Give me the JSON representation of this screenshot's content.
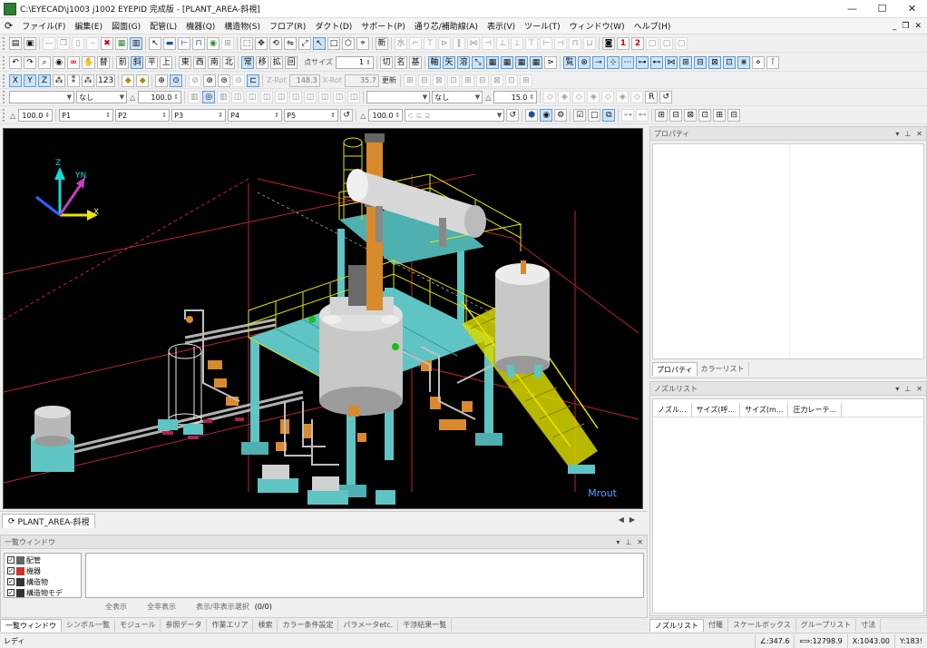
{
  "window": {
    "title": "C:\\EYECAD\\j1003 j1002 EYEPID 完成版 - [PLANT_AREA-斜視]",
    "minimize": "—",
    "maximize": "☐",
    "close": "✕"
  },
  "menu": [
    "ファイル(F)",
    "編集(E)",
    "図面(G)",
    "配管(L)",
    "機器(Q)",
    "構造物(S)",
    "フロア(R)",
    "ダクト(D)",
    "サポート(P)",
    "通り芯/補助線(A)",
    "表示(V)",
    "ツール(T)",
    "ウィンドウ(W)",
    "ヘルプ(H)"
  ],
  "mdi_controls": {
    "minimize": "_",
    "restore": "❐",
    "close": "✕"
  },
  "toolbar2": {
    "text_buttons": [
      "替",
      "前",
      "斜",
      "平",
      "上",
      "東",
      "西",
      "南",
      "北",
      "常",
      "移",
      "拡",
      "回"
    ],
    "point_size_label": "点サイズ",
    "point_size_value": "1",
    "text_buttons_b": [
      "切",
      "名",
      "基",
      "軸",
      "矢",
      "溶"
    ]
  },
  "toolbar3": {
    "zrot_label": "Z-Rot",
    "zrot_value": "148.3",
    "xrot_label": "X-Rot",
    "xrot_value": "35.7",
    "update_label": "更新"
  },
  "toolbar4": {
    "combo1": "",
    "combo2": "なし",
    "size_value": "100.0",
    "combo3": "",
    "combo4": "なし",
    "angle_value": "15.0",
    "r_label": "R"
  },
  "toolbar5": {
    "scale_value": "100.0",
    "params": [
      "P1",
      "P2",
      "P3",
      "P4",
      "P5"
    ]
  },
  "viewport": {
    "axis_x": "X",
    "axis_y": "YN",
    "axis_z": "Z",
    "overlay_text": "Mrout"
  },
  "doc_tab": {
    "label": "PLANT_AREA-斜視",
    "nav_prev": "◀",
    "nav_next": "▶"
  },
  "list_window": {
    "title": "一覧ウィンドウ",
    "tree_items": [
      "配管",
      "機器",
      "構造物",
      "構造物モデ"
    ],
    "btn_show_all": "全表示",
    "btn_hide_all": "全非表示",
    "btn_toggle": "表示/非表示選択",
    "count": "(0/0)"
  },
  "bottom_tabs": [
    "一覧ウィンドウ",
    "シンボル一覧",
    "モジュール",
    "参照データ",
    "作業エリア",
    "検索",
    "カラー条件設定",
    "パラメータetc.",
    "干渉結果一覧"
  ],
  "property_panel": {
    "title": "プロパティ",
    "tabs": [
      "プロパティ",
      "カラーリスト"
    ]
  },
  "nozzle_panel": {
    "title": "ノズルリスト",
    "columns": [
      "ノズル...",
      "サイズ(呼...",
      "サイズ(m...",
      "圧力レーテ..."
    ]
  },
  "right_bottom_tabs": [
    "ノズルリスト",
    "付羅",
    "スケールボックス",
    "グループリスト",
    "寸法"
  ],
  "status": {
    "ready": "レディ",
    "angle": "∠:347.6",
    "distance": "⟺:12798.9",
    "x": "X:1043.00",
    "y": "Y:183!"
  },
  "colors": {
    "steel": "#5fc4c4",
    "handrail": "#e6e600",
    "pipe_orange": "#d98a2c",
    "vessel": "#c8c8c8",
    "grid_line": "#c0203a",
    "accent_blue": "#4aa8ff"
  }
}
